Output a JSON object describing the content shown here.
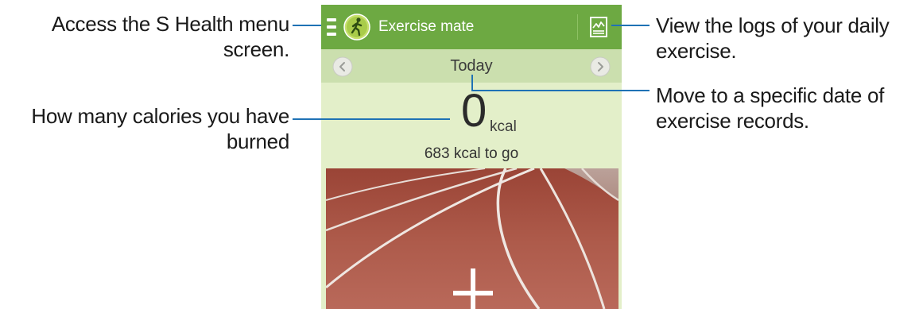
{
  "app": {
    "title": "Exercise mate",
    "menu_icon": "menu-icon",
    "logo_icon": "walker-icon",
    "logs_icon": "chart-log-icon",
    "bar_color": "#6da942"
  },
  "date_nav": {
    "label": "Today",
    "prev_icon": "chevron-left-icon",
    "next_icon": "chevron-right-icon"
  },
  "calories": {
    "value": "0",
    "unit": "kcal",
    "to_go": "683 kcal to go"
  },
  "track": {
    "add_icon": "plus-icon"
  },
  "callouts": {
    "menu": "Access the S Health menu screen.",
    "calories": "How many calories you have burned",
    "logs": "View the logs of your daily exercise.",
    "date": "Move to a specific date of exercise records."
  }
}
